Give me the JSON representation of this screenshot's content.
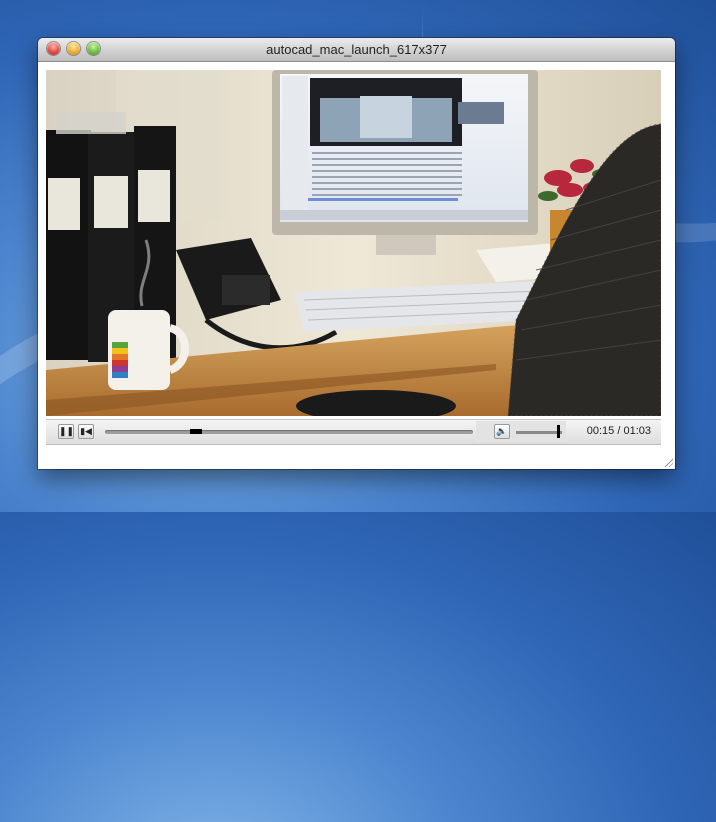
{
  "window": {
    "title": "autocad_mac_launch_617x377"
  },
  "player": {
    "time_display": "00:15 / 01:03",
    "progress_fraction": 0.24,
    "volume_fraction": 0.9,
    "state": "playing"
  },
  "icons": {
    "close": "close-icon",
    "minimize": "minimize-icon",
    "zoom": "zoom-icon",
    "pause": "pause-icon",
    "restart": "skip-back-icon",
    "volume": "speaker-icon",
    "resize": "resize-grip-icon"
  }
}
